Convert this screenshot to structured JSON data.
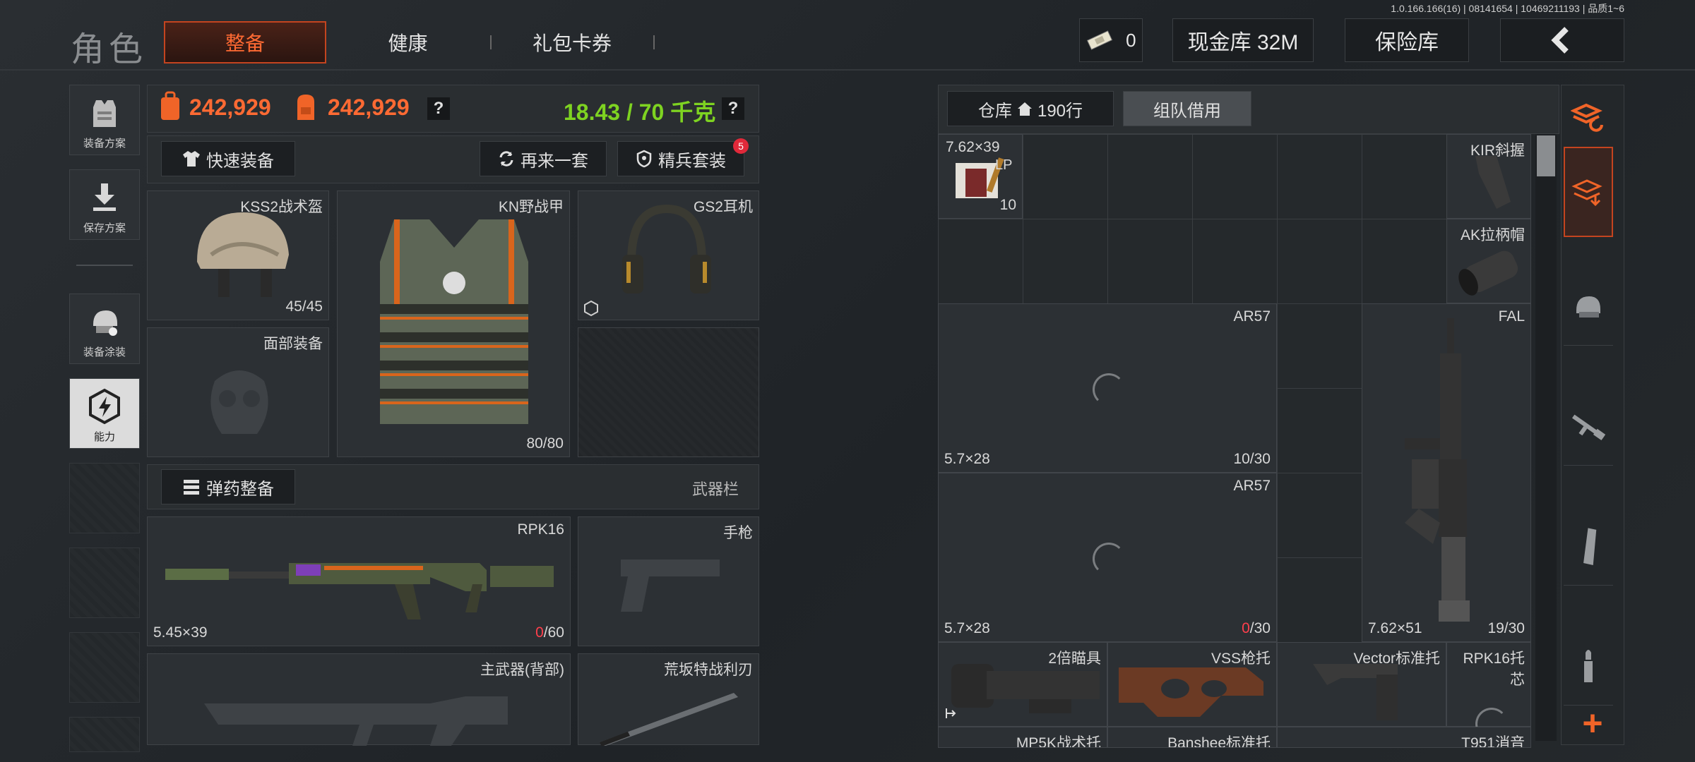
{
  "version": "1.0.166.166(16) | 08141654 | 10469211193 | 品质1~6",
  "header": {
    "title": "角色",
    "tabs": [
      {
        "label": "整备",
        "active": true
      },
      {
        "label": "健康"
      },
      {
        "label": "礼包卡券"
      }
    ],
    "currency_value": "0",
    "cash_vault": "现金库 32M",
    "safe_box": "保险库"
  },
  "sidebar": {
    "items": [
      {
        "label": "装备方案",
        "icon": "armor-vest-icon"
      },
      {
        "label": "保存方案",
        "icon": "download-icon"
      },
      {
        "label": "装备涂装",
        "icon": "helmet-paint-icon"
      },
      {
        "label": "能力",
        "icon": "lightning-hex-icon"
      }
    ]
  },
  "stats": {
    "value1": "242,929",
    "value2": "242,929",
    "weight": "18.43 / 70 千克",
    "help": "?"
  },
  "actions": {
    "quick_equip": "快速装备",
    "again": "再来一套",
    "elite": "精兵套装",
    "elite_badge": "5"
  },
  "gear": {
    "helmet": {
      "label": "KSS2战术盔",
      "count": "45/45"
    },
    "vest": {
      "label": "KN野战甲",
      "count": "80/80"
    },
    "headset": {
      "label": "GS2耳机"
    },
    "face": {
      "label": "面部装备"
    }
  },
  "weapons_header": {
    "ammo_equip": "弹药整备",
    "weapon_bar": "武器栏"
  },
  "weapons": {
    "primary": {
      "label": "RPK16",
      "caliber": "5.45×39",
      "ammo_cur": "0",
      "ammo_max": "/60"
    },
    "pistol": {
      "label": "手枪"
    },
    "back": {
      "label": "主武器(背部)"
    },
    "melee": {
      "label": "荒坂特战利刃"
    }
  },
  "storage": {
    "tab_warehouse": "仓库",
    "rows": "190行",
    "tab_team": "组队借用",
    "items": {
      "ammo": {
        "label": "7.62×39",
        "sub": "LP",
        "count": "10"
      },
      "kir": {
        "label": "KIR斜握"
      },
      "ak_cap": {
        "label": "AK拉柄帽"
      },
      "ar57a": {
        "label": "AR57",
        "caliber": "5.7×28",
        "count": "10/30"
      },
      "ar57b": {
        "label": "AR57",
        "caliber": "5.7×28",
        "count_cur": "0",
        "count_max": "/30"
      },
      "fal": {
        "label": "FAL",
        "caliber": "7.62×51",
        "count": "19/30"
      },
      "scope": {
        "label": "2倍瞄具"
      },
      "vss": {
        "label": "VSS枪托"
      },
      "vector": {
        "label": "Vector标准托"
      },
      "rpk_stock": {
        "label": "RPK16托芯"
      },
      "mp5k": {
        "label": "MP5K战术托"
      },
      "banshee": {
        "label": "Banshee标准托"
      },
      "t951": {
        "label": "T951消音"
      }
    }
  },
  "right_bar": {
    "add": "+"
  }
}
